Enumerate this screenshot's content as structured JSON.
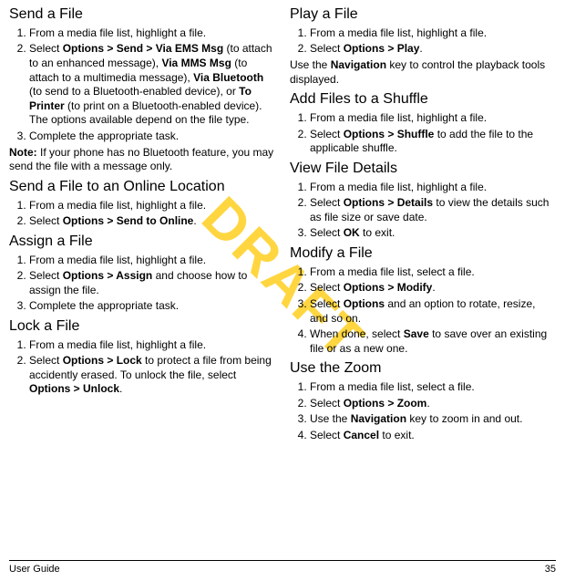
{
  "watermark": "DRAFT",
  "left": {
    "sendFile": {
      "title": "Send a File",
      "step1": "From a media file list, highlight a file.",
      "step2_a": "Select ",
      "step2_b": "Options > Send > Via EMS Msg",
      "step2_c": " (to attach to an enhanced message), ",
      "step2_d": "Via MMS Msg",
      "step2_e": " (to attach to a multimedia message), ",
      "step2_f": "Via Bluetooth",
      "step2_g": " (to send to a Bluetooth-enabled device), or ",
      "step2_h": "To Printer",
      "step2_i": " (to print on a Bluetooth-enabled device). The options available depend on the file type.",
      "step3": "Complete the appropriate task.",
      "note_a": "Note:",
      "note_b": " If your phone has no Bluetooth feature, you may send the file with a message only."
    },
    "sendOnline": {
      "title": "Send a File to an Online Location",
      "step1": "From a media file list, highlight a file.",
      "step2_a": "Select ",
      "step2_b": "Options > Send to Online",
      "step2_c": "."
    },
    "assign": {
      "title": "Assign a File",
      "step1": "From a media file list, highlight a file.",
      "step2_a": "Select ",
      "step2_b": "Options > Assign",
      "step2_c": " and choose how to assign the file.",
      "step3": "Complete the appropriate task."
    },
    "lock": {
      "title": "Lock a File",
      "step1": "From a media file list, highlight a file.",
      "step2_a": "Select ",
      "step2_b": "Options > Lock",
      "step2_c": " to protect a file from being accidently erased. To unlock the file, select ",
      "step2_d": "Options > Unlock",
      "step2_e": "."
    }
  },
  "right": {
    "play": {
      "title": "Play a File",
      "step1": "From a media file list, highlight a file.",
      "step2_a": "Select ",
      "step2_b": "Options > Play",
      "step2_c": ".",
      "use_a": "Use the ",
      "use_b": "Navigation",
      "use_c": " key to control the playback tools displayed."
    },
    "shuffle": {
      "title": "Add Files to a Shuffle",
      "step1": "From a media file list, highlight a file.",
      "step2_a": "Select ",
      "step2_b": "Options > Shuffle",
      "step2_c": " to add the file to the applicable shuffle."
    },
    "details": {
      "title": "View File Details",
      "step1": "From a media file list, highlight a file.",
      "step2_a": "Select ",
      "step2_b": "Options > Details",
      "step2_c": " to view the details such as file size or save date.",
      "step3_a": "Select ",
      "step3_b": "OK",
      "step3_c": " to exit."
    },
    "modify": {
      "title": "Modify a File",
      "step1": "From a media file list, select a file.",
      "step2_a": "Select ",
      "step2_b": "Options > Modify",
      "step2_c": ".",
      "step3_a": "Select ",
      "step3_b": "Options",
      "step3_c": " and an option to rotate, resize, and so on.",
      "step4_a": "When done, select ",
      "step4_b": "Save",
      "step4_c": " to save over an existing file or as a new one."
    },
    "zoom": {
      "title": "Use the Zoom",
      "step1": "From a media file list, select a file.",
      "step2_a": "Select ",
      "step2_b": "Options > Zoom",
      "step2_c": ".",
      "step3_a": "Use the ",
      "step3_b": "Navigation",
      "step3_c": " key to zoom in and out.",
      "step4_a": "Select ",
      "step4_b": "Cancel",
      "step4_c": " to exit."
    }
  },
  "footer": {
    "left": "User Guide",
    "right": "35"
  }
}
